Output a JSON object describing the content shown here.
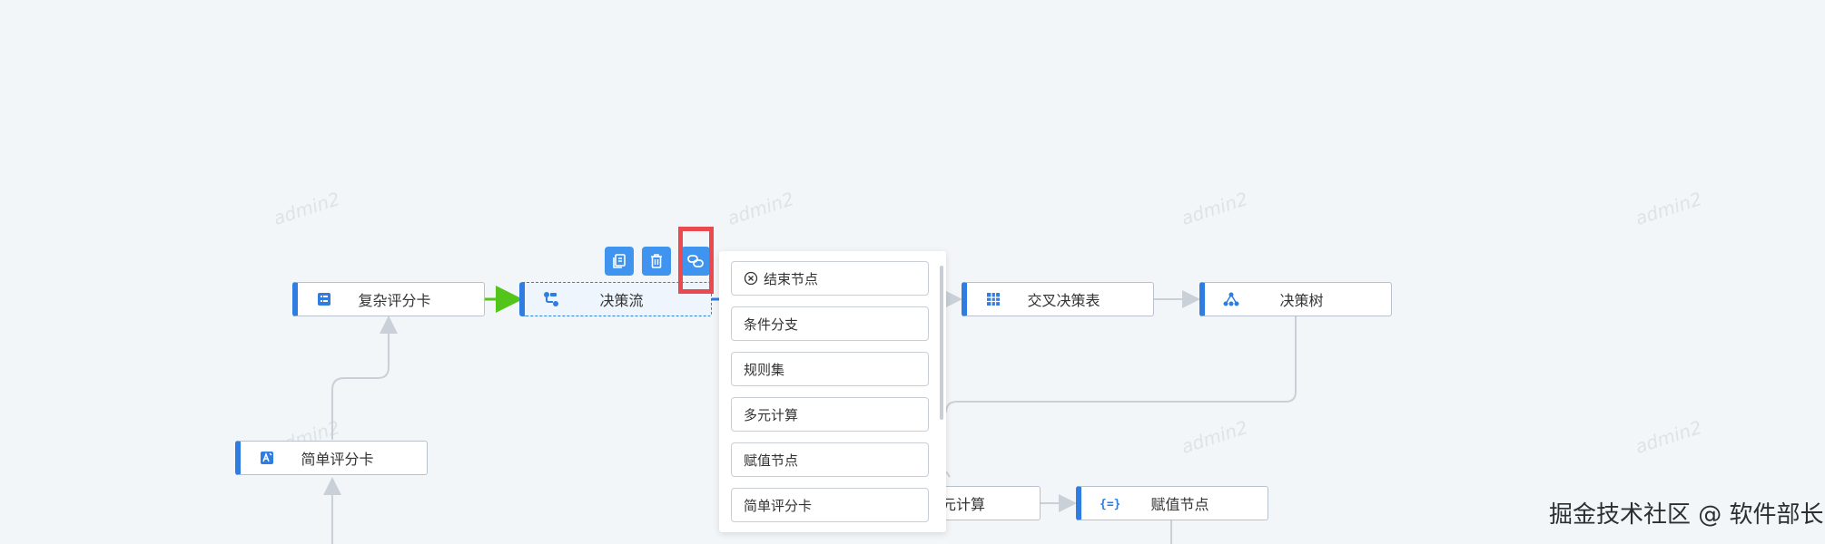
{
  "watermark_text": "admin2",
  "nodes": {
    "complex_scorecard": "复杂评分卡",
    "decision_flow": "决策流",
    "cross_table": "交叉决策表",
    "decision_tree": "决策树",
    "simple_scorecard": "简单评分卡",
    "multi_calc_partial": "元计算",
    "assign_node": "赋值节点"
  },
  "toolbar_icons": [
    "copy-icon",
    "delete-icon",
    "link-icon"
  ],
  "menu": {
    "items": [
      {
        "label": "结束节点",
        "icon": "close-circle-icon"
      },
      {
        "label": "条件分支"
      },
      {
        "label": "规则集"
      },
      {
        "label": "多元计算"
      },
      {
        "label": "赋值节点"
      },
      {
        "label": "简单评分卡"
      }
    ]
  },
  "footer": {
    "text": "掘金技术社区 @ 软件部长"
  },
  "colors": {
    "accent": "#2f7de1",
    "button": "#3e94ef",
    "highlight": "#ea4a4f",
    "edge": "#c9d0d7",
    "edge_active": "#52c41a"
  }
}
